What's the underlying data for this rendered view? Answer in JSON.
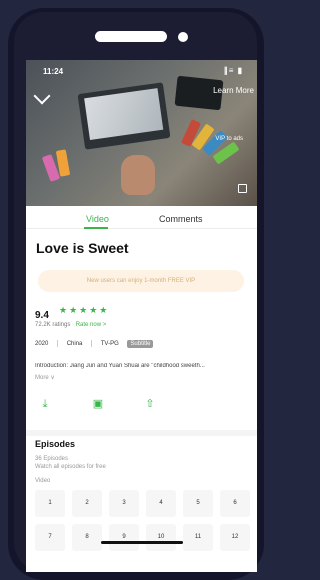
{
  "status": {
    "time": "11:24",
    "icons": "∥≡ ▮"
  },
  "player": {
    "learn_more": "Learn More",
    "vip_text": "VIP to ads"
  },
  "tabs": [
    {
      "label": "Video"
    },
    {
      "label": "Comments"
    }
  ],
  "show": {
    "title": "Love is Sweet",
    "promo": "New users can enjoy 1-month FREE VIP",
    "rating": "9.4",
    "stars": "★★★★★",
    "ratings_count": "72.2K ratings",
    "rate_now": "Rate now >",
    "year": "2020",
    "region": "China",
    "age": "TV-PG",
    "badge": "Subtitle",
    "intro": "Introduction: Jiang Jun and Yuan Shuai are \"childhood sweeth...",
    "more": "More ∨"
  },
  "episodes": {
    "title": "Episodes",
    "count": "36 Episodes",
    "subtitle": "Watch all episodes for free",
    "video_label": "Video",
    "items": [
      "1",
      "2",
      "3",
      "4",
      "5",
      "6",
      "7",
      "8",
      "9",
      "10",
      "11",
      "12"
    ]
  },
  "colors": {
    "accent": "#39b54a",
    "background": "#23263f",
    "promo_bg": "#fdf2e4"
  }
}
